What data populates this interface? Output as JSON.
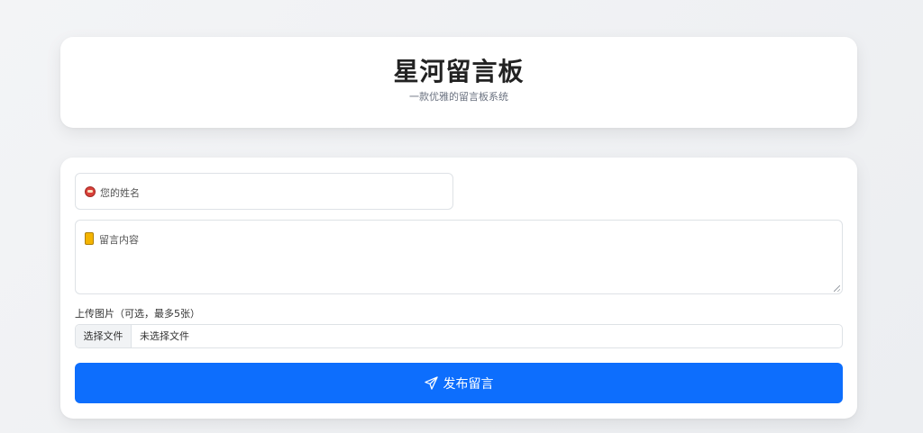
{
  "header": {
    "title": "星河留言板",
    "subtitle": "一款优雅的留言板系统"
  },
  "form": {
    "name_placeholder": "您的姓名",
    "name_icon": "mouth-emoji-icon",
    "content_placeholder": "留言内容",
    "content_icon": "notebook-emoji-icon",
    "upload_label": "上传图片（可选，最多5张）",
    "file_button_label": "选择文件",
    "file_status": "未选择文件",
    "submit_label": "发布留言",
    "submit_icon": "send-icon"
  },
  "colors": {
    "accent": "#0d6efd",
    "background": "#f3f4f6",
    "card": "#ffffff"
  }
}
